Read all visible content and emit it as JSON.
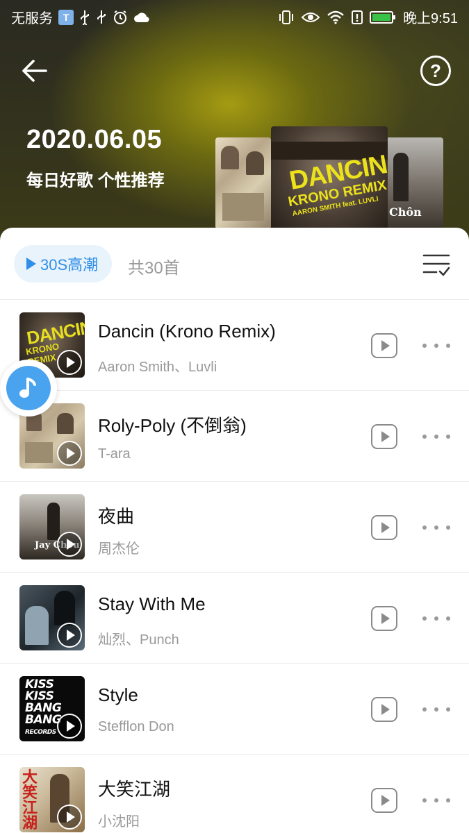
{
  "status_bar": {
    "carrier": "无服务",
    "time": "晚上9:51",
    "sim_badge": "T",
    "left_icons": [
      "sim-badge-icon",
      "usb-icon",
      "usb-icon",
      "alarm-icon",
      "cloud-icon"
    ],
    "right_icons": [
      "vibrate-icon",
      "eye-icon",
      "wifi-icon",
      "alert-icon",
      "battery-icon"
    ]
  },
  "header": {
    "date": "2020.06.05",
    "subtitle": "每日好歌 个性推荐",
    "covers": {
      "center": {
        "line1": "DANCIN",
        "line2": "KRONO REMIX",
        "line3": "AARON SMITH feat. LUVLI"
      },
      "right": {
        "line1": "Chôn"
      }
    }
  },
  "toolbar": {
    "preview_label": "30S高潮",
    "count_label": "共30首"
  },
  "songs": [
    {
      "title": "Dancin (Krono Remix)",
      "artist": "Aaron Smith、Luvli",
      "thumb_text": "DANCIN",
      "thumb_text2": "KRONO REMIX"
    },
    {
      "title": "Roly-Poly (不倒翁)",
      "artist": "T-ara"
    },
    {
      "title": "夜曲",
      "artist": "周杰伦",
      "thumb_text": "Jay Chou"
    },
    {
      "title": "Stay With Me",
      "artist": "灿烈、Punch"
    },
    {
      "title": "Style",
      "artist": "Stefflon Don",
      "thumb_lines": [
        "KISS",
        "KISS",
        "BANG",
        "BANG"
      ],
      "thumb_small": "RECORDS"
    },
    {
      "title": "大笑江湖",
      "artist": "小沈阳",
      "thumb_text": "大笑江湖"
    }
  ],
  "colors": {
    "accent": "#2f8ee8",
    "chip_bg": "#e9f3fc",
    "float_ball": "#4aa3ee",
    "cover_title": "#ece21c"
  }
}
